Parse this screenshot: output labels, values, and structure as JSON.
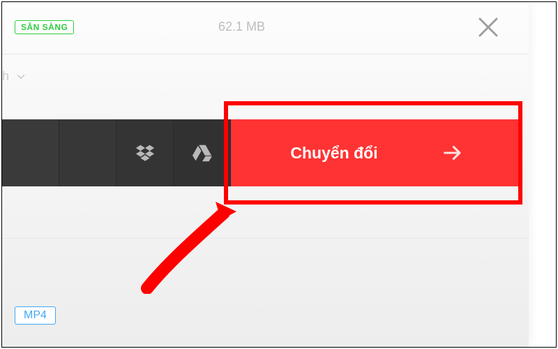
{
  "status_badge": "SẴN SÀNG",
  "file_size": "62.1 MB",
  "dropdown": {
    "visible_suffix": "h"
  },
  "convert_button": {
    "label": "Chuyển đổi"
  },
  "format_badge": "MP4",
  "icons": {
    "close": "close-icon",
    "chevron": "chevron-down-icon",
    "left_edge": "generic-dark-icon",
    "dropbox": "dropbox-icon",
    "drive": "google-drive-icon",
    "arrow_right": "arrow-right-icon"
  },
  "colors": {
    "accent_red": "#ff3333",
    "status_green": "#2ecc40",
    "format_blue": "#3fa9f5",
    "highlight": "#ff0000"
  }
}
